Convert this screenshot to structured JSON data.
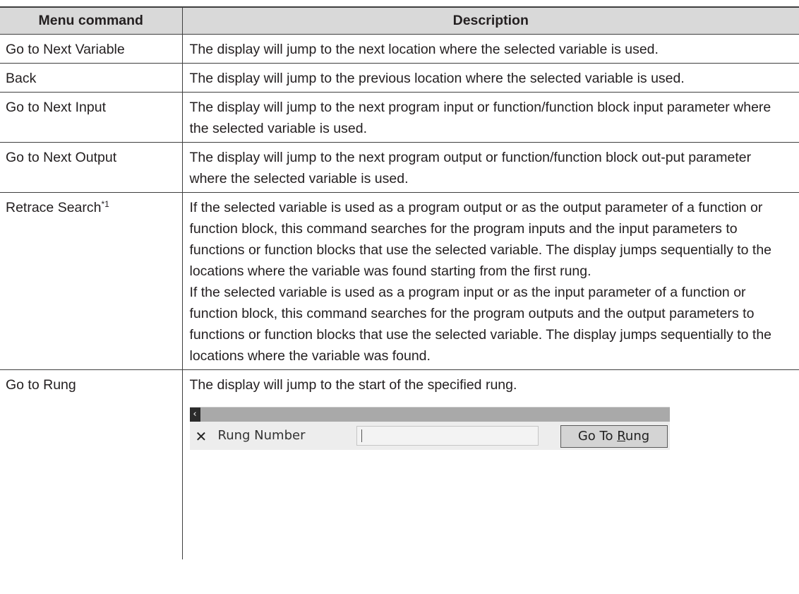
{
  "table": {
    "headers": [
      "Menu command",
      "Description"
    ],
    "rows": [
      {
        "command": "Go to Next Variable",
        "description": "The display will jump to the next location where the selected variable is used."
      },
      {
        "command": "Back",
        "description": "The display will jump to the previous location where the selected variable is used."
      },
      {
        "command": "Go to Next Input",
        "description": "The display will jump to the next program input or function/function block input parameter where the selected variable is used."
      },
      {
        "command": "Go to Next Output",
        "description": "The display will jump to the next program output or function/function block out-put parameter where the selected variable is used."
      },
      {
        "command": "Retrace Search",
        "command_sup": "*1",
        "description_1": "If the selected variable is used as a program output or as the output parameter of a function or function block, this command searches for the program inputs and the input parameters to functions or function blocks that use the selected variable. The display jumps sequentially to the locations where the variable was found starting from the first rung.",
        "description_2": "If the selected variable is used as a program input or as the input parameter of a function or function block, this command searches for the program outputs and the output parameters to functions or function blocks that use the selected variable. The display jumps sequentially to the locations where the variable was found."
      },
      {
        "command": "Go to Rung",
        "description": "The display will jump to the start of the specified rung."
      }
    ]
  },
  "rung_dialog": {
    "collapse_icon": "chevron-left-icon",
    "close_icon": "close-icon",
    "close_glyph": "✕",
    "label": "Rung Number",
    "input_value": "",
    "button_label_prefix": "Go To ",
    "button_label_underlined": "R",
    "button_label_suffix": "ung"
  }
}
